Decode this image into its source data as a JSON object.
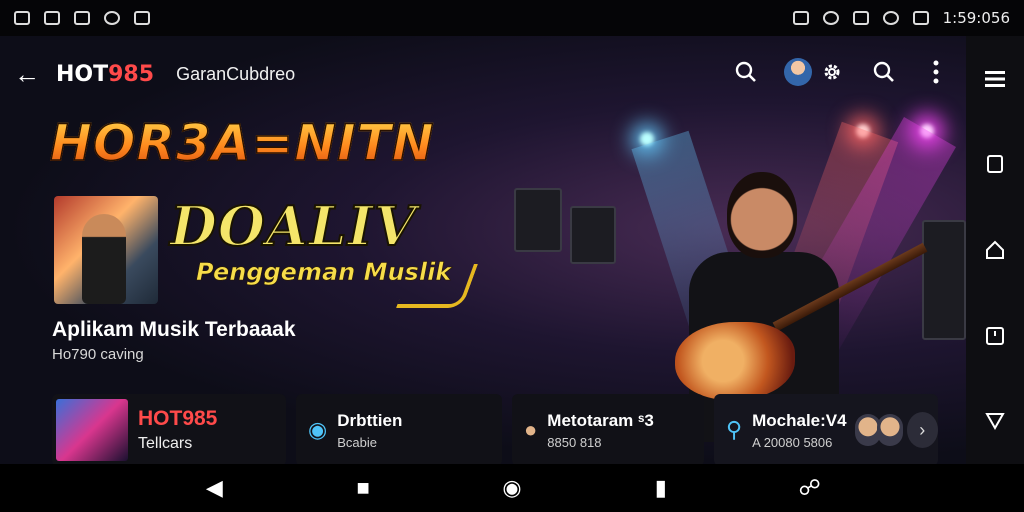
{
  "statusbar": {
    "time": "1:59:056"
  },
  "topbar": {
    "logo_white": "HOT",
    "logo_red": "985",
    "subtitle": "GaranCubdreo"
  },
  "hero": {
    "headline_line1": "HOR3A=NITN",
    "headline_line2": "DOALIV",
    "headline_line3": "Penggeman Muslik",
    "tagline": "Aplikam Musik  Terbaaak",
    "tagline_sub": "Ho790 caving"
  },
  "cards": [
    {
      "title": "HOT985",
      "subtitle": "Tellcars"
    },
    {
      "title": "Drbttien",
      "subtitle": "Bcabie"
    },
    {
      "title": "Metotaram ˢ3",
      "subtitle": "8850 818"
    },
    {
      "title": "Mochale:V4",
      "subtitle": "A 20080 5806"
    }
  ],
  "colors": {
    "accent": "#ff4a4a",
    "headline": "#ff8a1e",
    "icon_blue": "#4fc3f7"
  }
}
